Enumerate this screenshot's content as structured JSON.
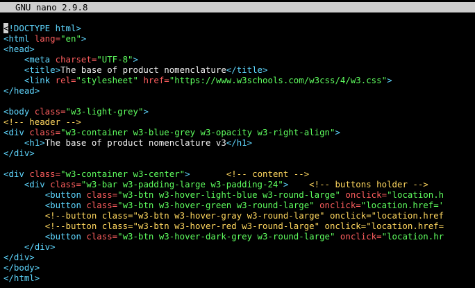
{
  "app": {
    "title": "GNU nano 2.9.8"
  },
  "colors": {
    "background": "#000000",
    "titlebar": "#cdcdcd",
    "tag": "#5fd7ff",
    "attribute": "#ff5f5f",
    "string": "#5fff5f",
    "comment": "#ffd75f",
    "text": "#f0f0f0"
  },
  "editor": {
    "lines": [
      [
        [
          "cursor",
          "<"
        ],
        [
          "tag",
          "!DOCTYPE html>"
        ]
      ],
      [
        [
          "tag",
          "<html "
        ],
        [
          "attr",
          "lang="
        ],
        [
          "str",
          "\"en\""
        ],
        [
          "tag",
          ">"
        ]
      ],
      [
        [
          "tag",
          "<head>"
        ]
      ],
      [
        [
          "txt",
          "    "
        ],
        [
          "tag",
          "<meta "
        ],
        [
          "attr",
          "charset="
        ],
        [
          "str",
          "\"UTF-8\""
        ],
        [
          "tag",
          ">"
        ]
      ],
      [
        [
          "txt",
          "    "
        ],
        [
          "tag",
          "<title>"
        ],
        [
          "txt",
          "The base of product nomenclature"
        ],
        [
          "tag",
          "</title>"
        ]
      ],
      [
        [
          "txt",
          "    "
        ],
        [
          "tag",
          "<link "
        ],
        [
          "attr",
          "rel="
        ],
        [
          "str",
          "\"stylesheet\" "
        ],
        [
          "attr",
          "href="
        ],
        [
          "str",
          "\"https://www.w3schools.com/w3css/4/w3.css\""
        ],
        [
          "tag",
          ">"
        ]
      ],
      [
        [
          "tag",
          "</head>"
        ]
      ],
      [],
      [
        [
          "tag",
          "<body "
        ],
        [
          "attr",
          "class="
        ],
        [
          "str",
          "\"w3-light-grey\""
        ],
        [
          "tag",
          ">"
        ]
      ],
      [
        [
          "cmt",
          "<!-- header -->"
        ]
      ],
      [
        [
          "tag",
          "<div "
        ],
        [
          "attr",
          "class="
        ],
        [
          "str",
          "\"w3-container w3-blue-grey w3-opacity w3-right-align\""
        ],
        [
          "tag",
          ">"
        ]
      ],
      [
        [
          "txt",
          "    "
        ],
        [
          "tag",
          "<h1>"
        ],
        [
          "txt",
          "The base of product nomenclature v3"
        ],
        [
          "tag",
          "</h1>"
        ]
      ],
      [
        [
          "tag",
          "</div>"
        ]
      ],
      [],
      [
        [
          "tag",
          "<div "
        ],
        [
          "attr",
          "class="
        ],
        [
          "str",
          "\"w3-container w3-center\""
        ],
        [
          "tag",
          ">"
        ],
        [
          "txt",
          "       "
        ],
        [
          "cmt",
          "<!-- content -->"
        ]
      ],
      [
        [
          "txt",
          "    "
        ],
        [
          "tag",
          "<div "
        ],
        [
          "attr",
          "class="
        ],
        [
          "str",
          "\"w3-bar w3-padding-large w3-padding-24\""
        ],
        [
          "tag",
          ">"
        ],
        [
          "txt",
          "    "
        ],
        [
          "cmt",
          "<!-- buttons holder -->"
        ]
      ],
      [
        [
          "txt",
          "        "
        ],
        [
          "tag",
          "<button "
        ],
        [
          "attr",
          "class="
        ],
        [
          "str",
          "\"w3-btn w3-hover-light-blue w3-round-large\" "
        ],
        [
          "attr",
          "onclick="
        ],
        [
          "str",
          "\"location.h"
        ]
      ],
      [
        [
          "txt",
          "        "
        ],
        [
          "tag",
          "<button "
        ],
        [
          "attr",
          "class="
        ],
        [
          "str",
          "\"w3-btn w3-hover-green w3-round-large\" "
        ],
        [
          "attr",
          "onclick="
        ],
        [
          "str",
          "\"location.href='"
        ]
      ],
      [
        [
          "txt",
          "        "
        ],
        [
          "cmt",
          "<!--button class=\"w3-btn w3-hover-gray w3-round-large\" onclick=\"location.href"
        ]
      ],
      [
        [
          "txt",
          "        "
        ],
        [
          "cmt",
          "<!--button class=\"w3-btn w3-hover-red w3-round-large\" onclick=\"location.href="
        ]
      ],
      [
        [
          "txt",
          "        "
        ],
        [
          "tag",
          "<button "
        ],
        [
          "attr",
          "class="
        ],
        [
          "str",
          "\"w3-btn w3-hover-dark-grey w3-round-large\" "
        ],
        [
          "attr",
          "onclick="
        ],
        [
          "str",
          "\"location.hr"
        ]
      ],
      [
        [
          "txt",
          "    "
        ],
        [
          "tag",
          "</div>"
        ]
      ],
      [
        [
          "tag",
          "</div>"
        ]
      ],
      [
        [
          "tag",
          "</body>"
        ]
      ],
      [
        [
          "tag",
          "</html>"
        ]
      ]
    ]
  }
}
